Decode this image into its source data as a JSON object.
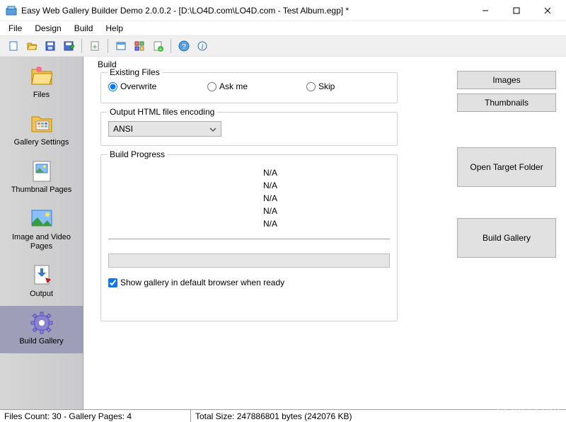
{
  "window": {
    "title": "Easy Web Gallery Builder Demo 2.0.0.2 - [D:\\LO4D.com\\LO4D.com - Test Album.egp] *",
    "minimize": "—",
    "maximize": "☐",
    "close": "✕"
  },
  "menubar": [
    "File",
    "Design",
    "Build",
    "Help"
  ],
  "toolbar_icons": [
    "new-icon",
    "open-icon",
    "save-icon",
    "save-as-icon",
    "sep",
    "add-icon",
    "sep",
    "window-icon",
    "grid-icon",
    "page-plus-icon",
    "sep",
    "help-icon",
    "info-icon"
  ],
  "sidebar": {
    "items": [
      {
        "label": "Files",
        "icon": "folder-open-icon"
      },
      {
        "label": "Gallery Settings",
        "icon": "folder-gallery-icon"
      },
      {
        "label": "Thumbnail Pages",
        "icon": "thumbnail-page-icon"
      },
      {
        "label": "Image and Video Pages",
        "icon": "image-video-icon"
      },
      {
        "label": "Output",
        "icon": "output-icon"
      },
      {
        "label": "Build Gallery",
        "icon": "gear-icon"
      }
    ],
    "active_index": 5
  },
  "build": {
    "section_label": "Build",
    "existing_files": {
      "legend": "Existing Files",
      "options": [
        "Overwrite",
        "Ask me",
        "Skip"
      ],
      "selected": 0
    },
    "encoding": {
      "legend": "Output HTML files encoding",
      "value": "ANSI"
    },
    "progress": {
      "legend": "Build Progress",
      "lines": [
        "N/A",
        "N/A",
        "N/A",
        "N/A",
        "N/A"
      ]
    },
    "show_in_browser": {
      "checked": true,
      "label": "Show gallery in default browser when ready"
    }
  },
  "right_buttons": {
    "images": "Images",
    "thumbnails": "Thumbnails",
    "open_target": "Open Target Folder",
    "build_gallery": "Build Gallery"
  },
  "statusbar": {
    "left": "Files Count: 30 - Gallery Pages: 4",
    "right": "Total Size: 247886801 bytes (242076 KB)"
  },
  "watermark": "LO4D.com"
}
